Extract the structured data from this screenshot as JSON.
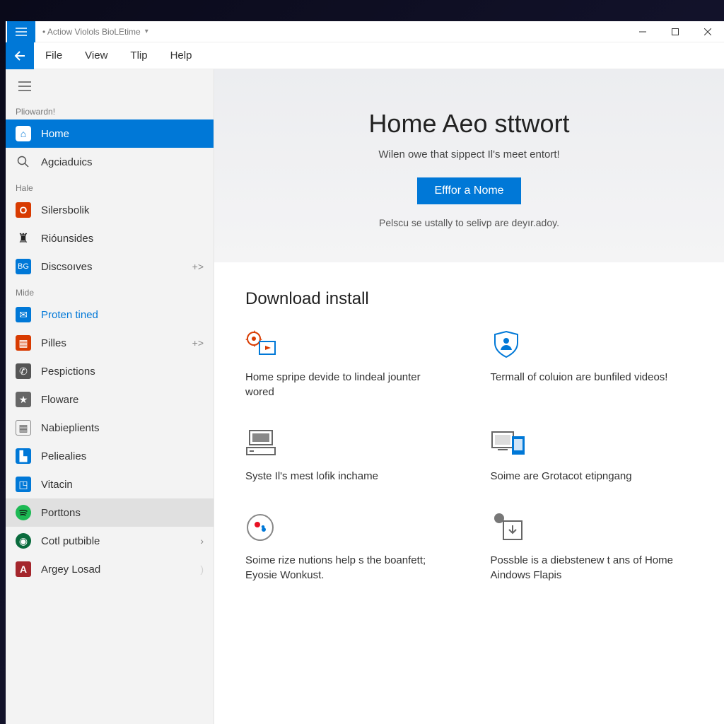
{
  "titlebar": {
    "title": "• Actiow Violols BioLEtime",
    "dropdown_glyph": "▾"
  },
  "menubar": {
    "file": "File",
    "view": "View",
    "trip": "Tlip",
    "help": "Help"
  },
  "sidebar": {
    "section1_label": "Pliowardn!",
    "home": "Home",
    "agciaduics": "Agciaduics",
    "section2_label": "Hale",
    "silersbolik": "Silersbolik",
    "riounsides": "Rióunsides",
    "discsowes": "Discsoıves",
    "section3_label": "Mide",
    "proten": "Proten tined",
    "pilles": "Pilles",
    "pespictions": "Pespictions",
    "floware": "Floware",
    "nabieplients": "Nabieplients",
    "peliealies": "Peliealies",
    "vitacin": "Vitacin",
    "porttons": "Porttons",
    "codputbible": "Cotl putbible",
    "argey": "Argey Losad",
    "arrow_glyph": "+>",
    "chevron_glyph": "›"
  },
  "hero": {
    "title": "Home Aeo sttwort",
    "subtitle": "Wilen owe that sippect Il's meet entort!",
    "button": "Efffor a Nome",
    "note": "Pelscu se ustally to selivp are deyır.adoy."
  },
  "downloads": {
    "heading": "Download install",
    "card1": "Home spripe devide to lindeal jounter wored",
    "card2": "Termall of coluion are bunfiled videos!",
    "card3": "Syste Il's mest lofik inchame",
    "card4": "Soime are Grotacot etipngang",
    "card5": "Soime rize nutions help s the boanfett; Eyosie Wonkust.",
    "card6": "Possble is a diebstenew t ans of Home Aindows Flapis"
  }
}
